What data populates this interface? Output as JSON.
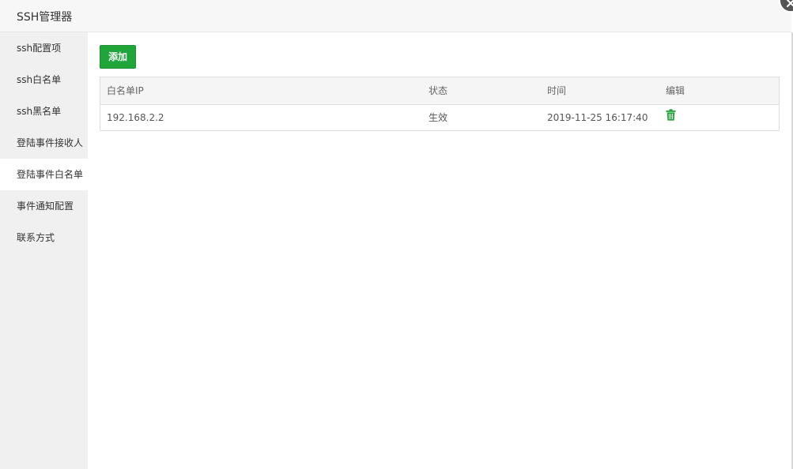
{
  "window": {
    "title": "SSH管理器"
  },
  "sidebar": {
    "items": [
      {
        "label": "ssh配置项"
      },
      {
        "label": "ssh白名单"
      },
      {
        "label": "ssh黑名单"
      },
      {
        "label": "登陆事件接收人"
      },
      {
        "label": "登陆事件白名单"
      },
      {
        "label": "事件通知配置"
      },
      {
        "label": "联系方式"
      }
    ],
    "active_index": 4
  },
  "toolbar": {
    "add_label": "添加"
  },
  "table": {
    "headers": [
      "白名单IP",
      "状态",
      "时间",
      "编辑"
    ],
    "rows": [
      {
        "ip": "192.168.2.2",
        "status": "生效",
        "time": "2019-11-25 16:17:40",
        "edit_icon": "trash-icon"
      }
    ]
  },
  "colors": {
    "accent": "#20a53a",
    "sidebar_bg": "#f0f0f0",
    "header_bg": "#f5f5f5"
  },
  "icons": {
    "close": "close-icon",
    "delete": "trash-icon"
  }
}
